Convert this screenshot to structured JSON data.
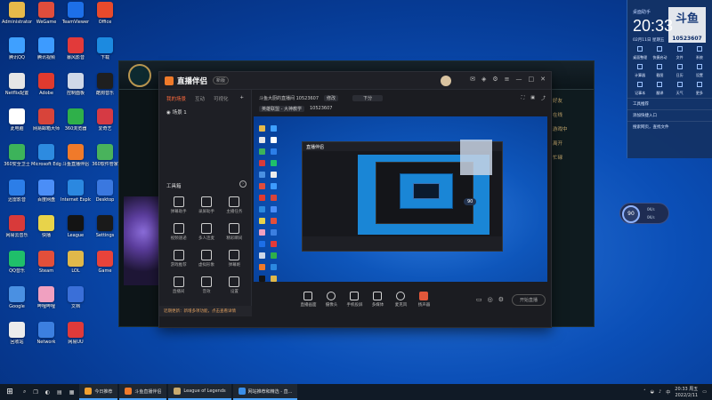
{
  "desktop": {
    "icons": [
      {
        "label": "Administrator",
        "color": "#e7b94a"
      },
      {
        "label": "腾讯QQ",
        "color": "#3fa0ff"
      },
      {
        "label": "Netflix配置",
        "color": "#e6e6e6"
      },
      {
        "label": "此电脑",
        "color": "#ffffff"
      },
      {
        "label": "360安全卫士",
        "color": "#3cb35a"
      },
      {
        "label": "迅雷影音",
        "color": "#2c7ee8"
      },
      {
        "label": "网易云音乐",
        "color": "#d83a3a"
      },
      {
        "label": "QQ音乐",
        "color": "#1fbf6a"
      },
      {
        "label": "Google",
        "color": "#4a90e2"
      },
      {
        "label": "回收站",
        "color": "#ececec"
      },
      {
        "label": "WeGame",
        "color": "#e04d3c"
      },
      {
        "label": "腾讯视频",
        "color": "#3d9bff"
      },
      {
        "label": "Adobe",
        "color": "#e03a2e"
      },
      {
        "label": "网易邮箱大师",
        "color": "#d8443a"
      },
      {
        "label": "Microsoft Edge",
        "color": "#2d8be0"
      },
      {
        "label": "百度网盘",
        "color": "#4b8ef7"
      },
      {
        "label": "快播",
        "color": "#e8d34a"
      },
      {
        "label": "Steam",
        "color": "#e24f3a"
      },
      {
        "label": "哔哩哔哩",
        "color": "#f0a0c0"
      },
      {
        "label": "Network",
        "color": "#3c7fe0"
      },
      {
        "label": "TeamViewer",
        "color": "#1d6fe8"
      },
      {
        "label": "暴风影音",
        "color": "#e23a3a"
      },
      {
        "label": "控制面板",
        "color": "#cfd8e8"
      },
      {
        "label": "360浏览器",
        "color": "#2fb04a"
      },
      {
        "label": "斗鱼直播伴侣",
        "color": "#f07a2a"
      },
      {
        "label": "Internet Explorer",
        "color": "#2b88e0"
      },
      {
        "label": "League",
        "color": "#141414"
      },
      {
        "label": "LOL",
        "color": "#e0b84a"
      },
      {
        "label": "文档",
        "color": "#3a6fd8"
      },
      {
        "label": "网易UU",
        "color": "#e03a3a"
      },
      {
        "label": "Office",
        "color": "#e84a2c"
      },
      {
        "label": "下载",
        "color": "#1c8ae0"
      },
      {
        "label": "酷狗音乐",
        "color": "#1f1f1f"
      },
      {
        "label": "爱奇艺",
        "color": "#d63a44"
      },
      {
        "label": "360软件管家",
        "color": "#49b35c"
      },
      {
        "label": "Desktop",
        "color": "#3a78e0"
      },
      {
        "label": "Settings",
        "color": "#1a1a1a"
      },
      {
        "label": "Game",
        "color": "#e8433a"
      }
    ]
  },
  "league_window": {
    "right_items": [
      "好友",
      "在线",
      "游戏中",
      "离开",
      "忙碌"
    ]
  },
  "app": {
    "name": "直播伴侣",
    "version_badge": "新版",
    "left_tabs": [
      "我的场景",
      "互动",
      "可视化"
    ],
    "scene_label": "场景 1",
    "tools_title": "工具箱",
    "tools": [
      "弹幕助手",
      "录屏助手",
      "主播任务",
      "视频速递",
      "多人连麦",
      "精彩瞬间",
      "游戏推荐",
      "虚拟形象",
      "弹幕姬",
      "直播间",
      "音效",
      "设置"
    ],
    "notice": "近期更新：新增多项功能，点击查看详情",
    "room_title": "斗鱼大厨的直播间 10523607",
    "edit_label": "修改",
    "category_label": "下分",
    "room_meta_label": "英雄联盟 - 大神教学",
    "room_id_label": "10523607",
    "controls": [
      "直播画面",
      "摄像头",
      "手机投屏",
      "多媒体",
      "麦克风",
      "扬声器"
    ],
    "start_button": "开始直播"
  },
  "widget": {
    "title": "桌面助手",
    "time": "20:33",
    "date": "02月11日  星期五",
    "logo_text": "斗鱼",
    "room_number": "10523607",
    "grid": [
      "桌面整理",
      "快捷启动",
      "文件",
      "系统",
      "计算器",
      "截图",
      "日历",
      "设置",
      "记事本",
      "翻译",
      "天气",
      "更多"
    ],
    "rows": [
      "工具推荐",
      "添加快捷入口",
      "搜索网页，查找文件"
    ]
  },
  "gauge": {
    "value": "90",
    "unit": "%",
    "up": "0K/s",
    "down": "0K/s"
  },
  "taskbar": {
    "apps": [
      {
        "label": "今日推荐",
        "color": "#f0a030"
      },
      {
        "label": "斗鱼直播伴侣",
        "color": "#f07a2a"
      },
      {
        "label": "League of Legends",
        "color": "#c8aa6e"
      },
      {
        "label": "网站推荐和精选 - 直...",
        "color": "#3a8ee8"
      }
    ],
    "time": "20:33 周五",
    "date": "2022/2/11"
  }
}
